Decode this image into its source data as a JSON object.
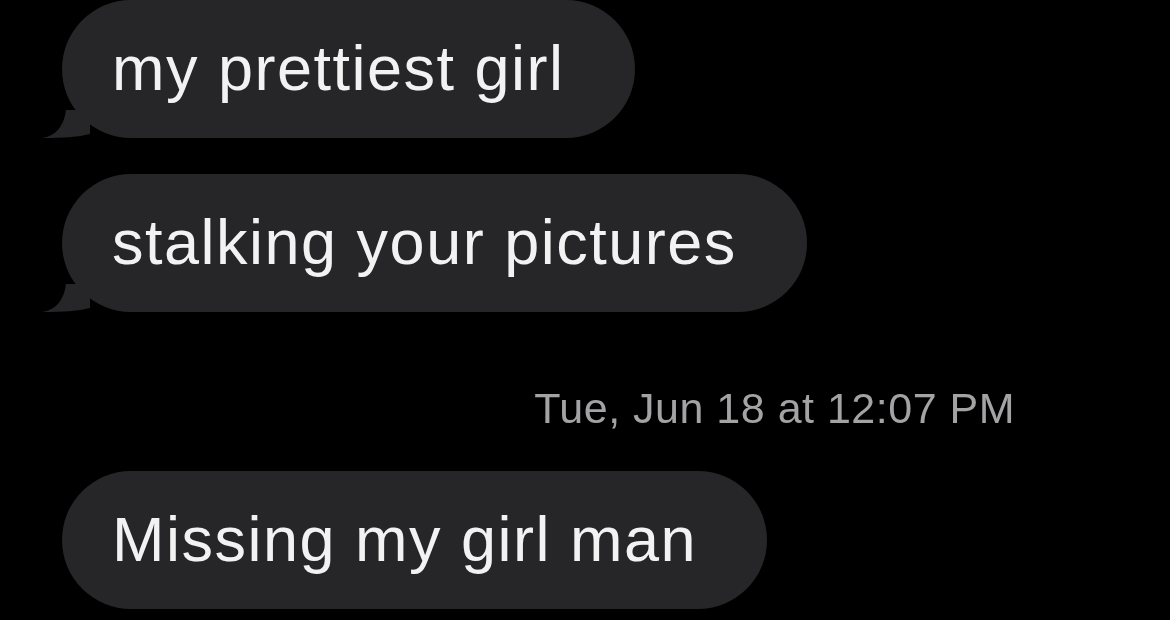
{
  "conversation": [
    {
      "kind": "bubble",
      "text": "my prettiest girl",
      "tail": true
    },
    {
      "kind": "bubble",
      "text": "stalking your pictures",
      "tail": true
    },
    {
      "kind": "timestamp",
      "text": "Tue, Jun 18 at 12:07 PM"
    },
    {
      "kind": "bubble",
      "text": "Missing my girl man",
      "tail": false
    }
  ]
}
